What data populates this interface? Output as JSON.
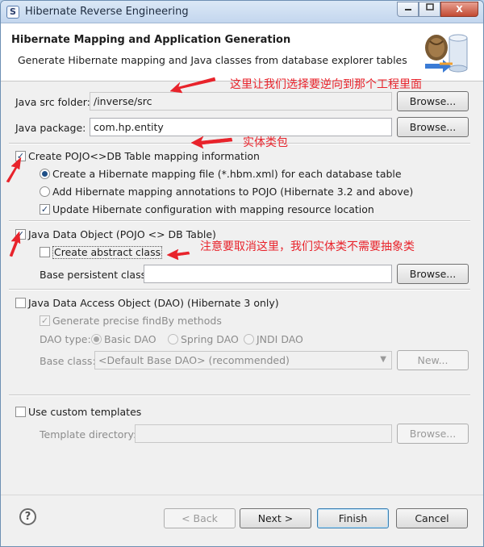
{
  "window": {
    "title": "Hibernate Reverse Engineering",
    "icon": "eclipse-icon",
    "controls": [
      "minimize",
      "maximize",
      "close"
    ],
    "close_glyph": "X",
    "app_icon_glyph": "S"
  },
  "banner": {
    "title": "Hibernate Mapping and Application Generation",
    "subtitle": "Generate Hibernate mapping and Java classes from database explorer tables"
  },
  "src_folder": {
    "label": "Java src folder:",
    "value": "/inverse/src",
    "browse": "Browse..."
  },
  "package": {
    "label": "Java package:",
    "value": "com.hp.entity",
    "browse": "Browse..."
  },
  "pojo_mapping": {
    "label": "Create POJO<>DB Table mapping information",
    "checked": true,
    "option_hbm": "Create a Hibernate mapping file (*.hbm.xml) for each database table",
    "option_annotations": "Add Hibernate mapping annotations to POJO (Hibernate 3.2 and above)",
    "update_config": "Update Hibernate configuration with mapping resource location"
  },
  "java_data_object": {
    "label": "Java Data Object (POJO <> DB Table)",
    "checked": true,
    "abstract_class": "Create abstract class",
    "base_persistent_label": "Base persistent class:",
    "base_persistent_value": "",
    "browse": "Browse..."
  },
  "dao": {
    "label": "Java Data Access Object (DAO) (Hibernate 3 only)",
    "checked": false,
    "precise_findby": "Generate precise findBy methods",
    "dao_type_label": "DAO type:",
    "types": [
      "Basic DAO",
      "Spring DAO",
      "JNDI DAO"
    ],
    "selected_type": "Basic DAO",
    "base_class_label": "Base class:",
    "base_class_value": "<Default Base DAO> (recommended)",
    "new_button": "New..."
  },
  "templates": {
    "label": "Use custom templates",
    "checked": false,
    "directory_label": "Template directory:",
    "directory_value": "",
    "browse": "Browse..."
  },
  "footer": {
    "help": "?",
    "back": "< Back",
    "next": "Next >",
    "finish": "Finish",
    "cancel": "Cancel"
  },
  "annotations": [
    "这里让我们选择要逆向到那个工程里面",
    "实体类包",
    "注意要取消这里，我们实体类不需要抽象类"
  ],
  "colors": {
    "annotation": "#e8232b",
    "arrow": "#e8232b"
  }
}
